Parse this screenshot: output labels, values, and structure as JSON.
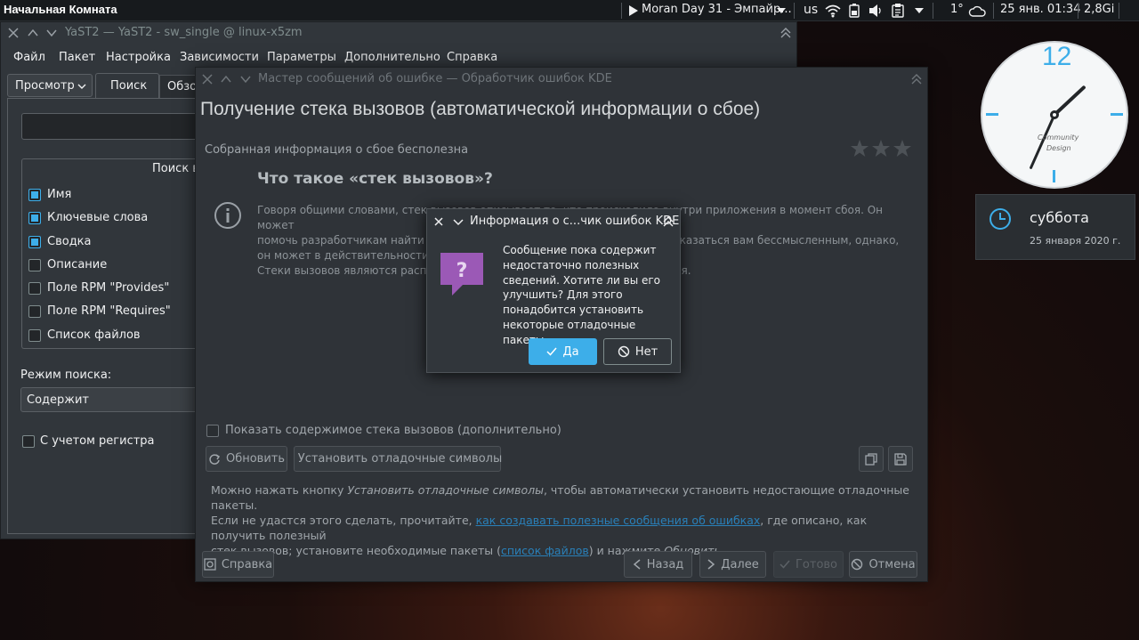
{
  "panel": {
    "activity": "Начальная Комната",
    "media": "Moran Day 31 - Эмпайр...",
    "kbd_layout": "us",
    "temperature": "1°",
    "datetime": "25 янв. 01:34",
    "memory": "2,8Gi",
    "icons": [
      "play-icon",
      "chevron-down-icon",
      "wifi-icon",
      "battery-icon",
      "volume-icon",
      "clipboard-icon",
      "chevron-down-icon",
      "weather-cloud-icon"
    ]
  },
  "clock_widget": {
    "hour_label": "12",
    "brand_line1": "Community",
    "brand_line2": "Design",
    "time": {
      "hour": 1,
      "minute": 34
    }
  },
  "calendar_widget": {
    "day": "суббота",
    "date": "25 января 2020 г.",
    "icon": "clock-icon"
  },
  "yast": {
    "title": "YaST2 — YaST2 - sw_single @ linux-x5zm",
    "menu": [
      "Файл",
      "Пакет",
      "Настройка",
      "Зависимости",
      "Параметры",
      "Дополнительно",
      "Справка"
    ],
    "view_dropdown": "Просмотр",
    "tabs": [
      "Поиск",
      "Обзор"
    ],
    "search_group_title": "Поиск в",
    "search_fields": [
      {
        "label": "Имя",
        "checked": true
      },
      {
        "label": "Ключевые слова",
        "checked": true
      },
      {
        "label": "Сводка",
        "checked": true
      },
      {
        "label": "Описание",
        "checked": false
      },
      {
        "label": "Поле RPM \"Provides\"",
        "checked": false
      },
      {
        "label": "Поле RPM \"Requires\"",
        "checked": false
      },
      {
        "label": "Список файлов",
        "checked": false
      }
    ],
    "mode_label": "Режим поиска:",
    "mode_value": "Содержит",
    "case_label": "С учетом регистра"
  },
  "wizard": {
    "title": "Мастер сообщений об ошибке — Обработчик ошибок KDE",
    "heading": "Получение стека вызовов (автоматической информации о сбое)",
    "usefulness": "Собранная информация о сбое бесполезна",
    "rating_stars": 0,
    "question": "Что такое «стек вызовов»?",
    "para_line1": "Говоря общими словами, стек вызовов описывает то, что происходило внутри приложения в момент сбоя. Он может",
    "para_line2": "помочь разработчикам найти и исправить ошибку. Информация может показаться вам бессмысленным, однако,",
    "para_line3": "он может в действительности содержать много полезных сведений.",
    "para_line4": "Стеки вызовов являются распространённым средством отладки после сбоя.",
    "show_backtrace": "Показать содержимое стека вызовов (дополнительно)",
    "reload": "Обновить",
    "install_symbols": "Установить отладочные символы",
    "note_a": "Можно нажать кнопку ",
    "note_b": "Установить отладочные символы",
    "note_c": ", чтобы автоматически установить недостающие отладочные пакеты.",
    "note_d": "Если не удастся этого сделать, прочитайте, ",
    "note_link1": "как создавать полезные сообщения об ошибках",
    "note_e": ", где описано, как получить полезный",
    "note_f": "стек вызовов; установите необходимые пакеты (",
    "note_link2": "список файлов",
    "note_g": ") и нажмите ",
    "note_h": "Обновить",
    "note_i": ".",
    "help": "Справка",
    "back": "Назад",
    "next": "Далее",
    "finish": "Готово",
    "cancel": "Отмена"
  },
  "dialog": {
    "title": "Информация о с...чик ошибок KDE",
    "message_l1": "Сообщение пока содержит",
    "message_l2": "недостаточно полезных",
    "message_l3": "сведений. Хотите ли вы его",
    "message_l4": "улучшить? Для этого",
    "message_l5": "понадобится установить",
    "message_l6": "некоторые отладочные пакеты.",
    "yes": "Да",
    "no": "Нет"
  },
  "colors": {
    "accent": "#3daee9",
    "window_bg": "#31363b",
    "dialog_icon": "#9b59b6",
    "panel": "#171a1d"
  }
}
